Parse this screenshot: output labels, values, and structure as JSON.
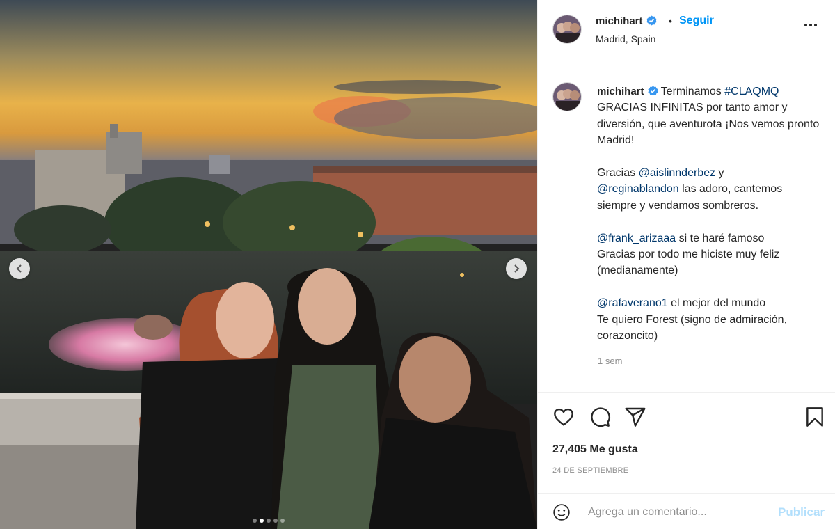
{
  "post": {
    "username": "michihart",
    "follow_label": "Seguir",
    "separator": "•",
    "location": "Madrid, Spain",
    "more_icon": "more-options-icon"
  },
  "carousel": {
    "slides_total": 5,
    "active_index": 1,
    "prev_icon": "chevron-left-icon",
    "next_icon": "chevron-right-icon"
  },
  "caption": {
    "username": "michihart",
    "line1_text": "Terminamos ",
    "line1_hashtag": "#CLAQMQ",
    "line2": "GRACIAS INFINITAS por tanto amor y diversión, que aventurota ¡Nos vemos pronto Madrid!",
    "p2_prefix": "Gracias ",
    "p2_mention1": "@aislinnderbez",
    "p2_mid": " y",
    "p2_mention2": "@reginablandon",
    "p2_suffix": " las adoro, cantemos siempre y vendamos sombreros.",
    "p3_mention": "@frank_arizaaa",
    "p3_suffix": " si te haré famoso",
    "p3_line2": "Gracias por todo me hiciste muy feliz (medianamente)",
    "p4_mention": "@rafaverano1",
    "p4_suffix": " el mejor del mundo",
    "p4_line2": "Te quiero Forest (signo de admiración, corazoncito)",
    "time_ago": "1 sem"
  },
  "actions": {
    "like_icon": "heart-icon",
    "comment_icon": "comment-icon",
    "share_icon": "share-icon",
    "save_icon": "bookmark-icon",
    "likes": "27,405 Me gusta",
    "date": "24 DE SEPTIEMBRE"
  },
  "comment_box": {
    "emoji_icon": "emoji-icon",
    "placeholder": "Agrega un comentario...",
    "publish_label": "Publicar"
  },
  "colors": {
    "link": "#00376b",
    "follow": "#0095f6",
    "publish_disabled": "#b2dffc",
    "verified": "#3897f0"
  }
}
